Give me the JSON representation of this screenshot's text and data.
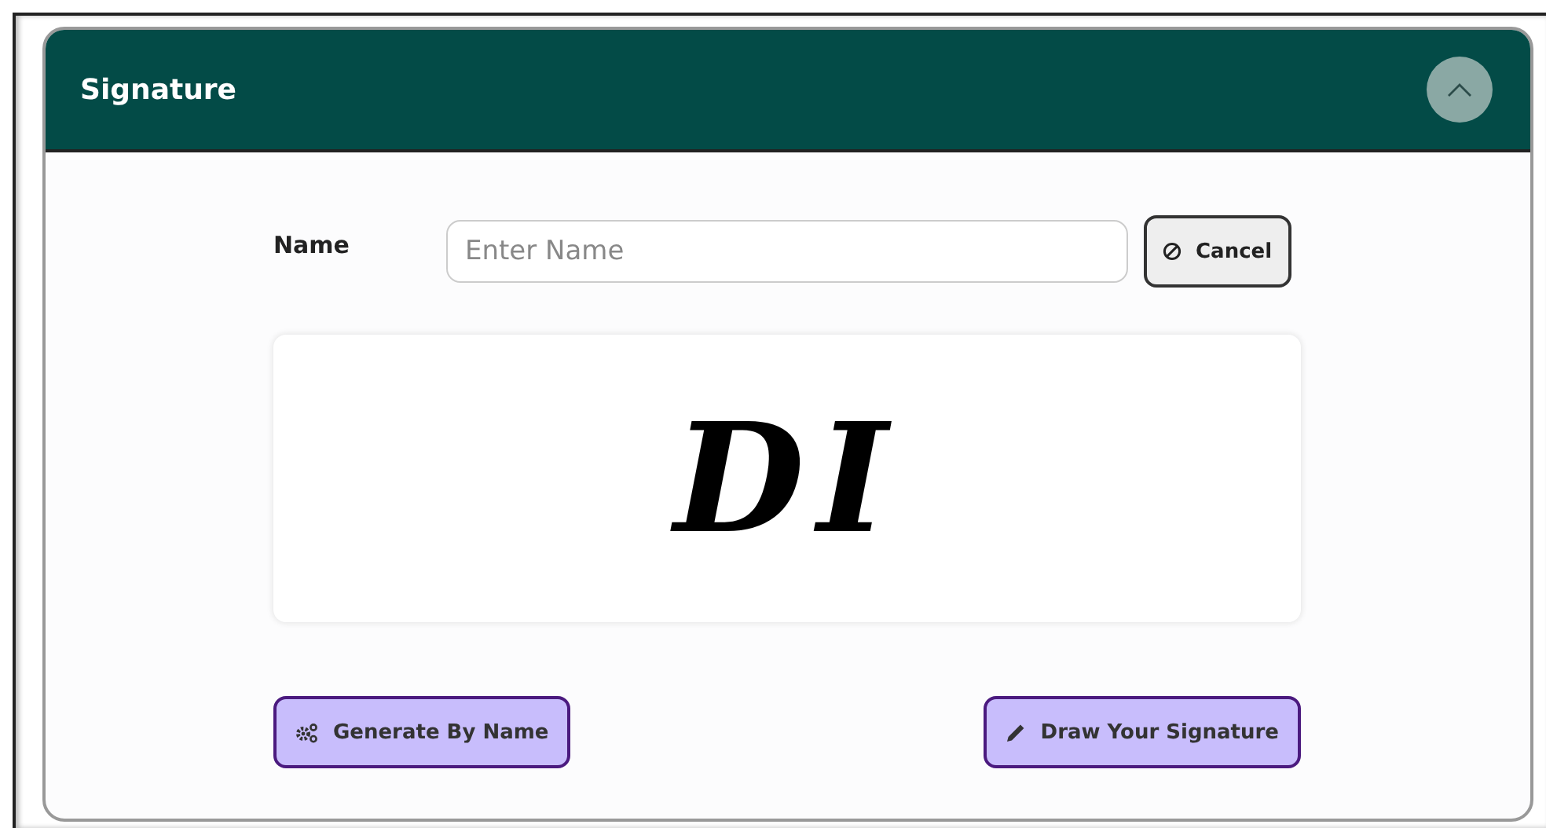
{
  "panel": {
    "title": "Signature",
    "expanded": true
  },
  "name_field": {
    "label": "Name",
    "placeholder": "Enter Name"
  },
  "cancel_button": {
    "label": "Cancel"
  },
  "signature": {
    "text": "DI"
  },
  "buttons": [
    {
      "kind": "generate",
      "label": "Generate By Name"
    },
    {
      "kind": "draw",
      "label": "Draw Your Signature"
    }
  ]
}
